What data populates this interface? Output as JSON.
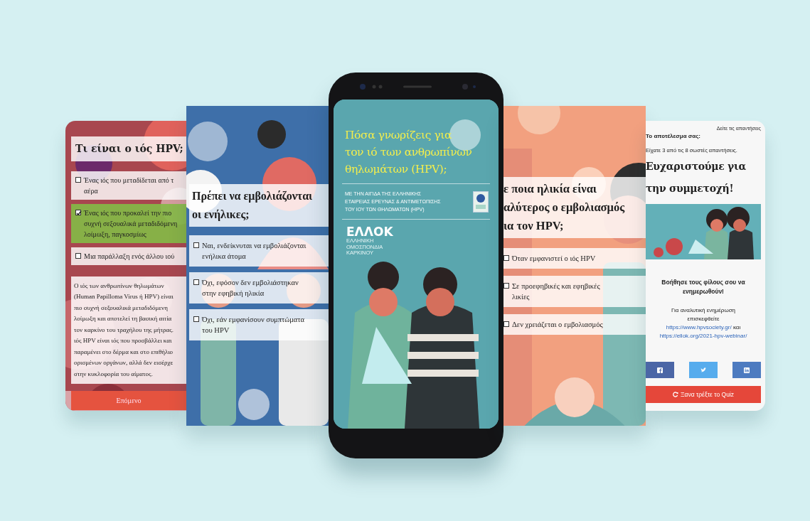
{
  "screens": [
    {
      "kind": "quiz",
      "title": "Τι είναι ο ιός HPV;",
      "options": [
        {
          "text": "Ένας ιός που μεταδίδεται από τ\nαέρα",
          "selected": false
        },
        {
          "text": "Ένας ιός που προκαλεί την πιο\nσυχνή σεξουαλικά μεταδιδόμενη\nλοίμωξη, παγκοσμίως",
          "selected": true
        },
        {
          "text": "Μια παράλλαξη ενός άλλου ιού",
          "selected": false
        }
      ],
      "explanation": "Ο ιός των ανθρωπίνων θηλωμάτων\n(Human Papilloma Virus ή HPV) είναι\nπιο συχνή σεξουαλικά μεταδιδόμενη\nλοίμωξη και αποτελεί τη βασική αιτία\nτον καρκίνο του τραχήλου της μήτρας.\nιός HPV είναι ιός που προσβάλλει και\nπαραμένει στο δέρμα και στο επιθήλιο\nορισμένων οργάνων, αλλά δεν εισέρχε\nστην κυκλοφορία του αίματος.",
      "next_button": "Επόμενο"
    },
    {
      "kind": "quiz",
      "title": "Πρέπει να εμβολιάζονται\nοι ενήλικες;",
      "options": [
        {
          "text": "Ναι, ενδείκνυται να εμβολιάζονται\nενήλικα άτομα",
          "selected": false
        },
        {
          "text": "Όχι, εφόσον δεν εμβολιάστηκαν\nστην εφηβική ηλικία",
          "selected": false
        },
        {
          "text": "Όχι, εάν εμφανίσουν συμπτώματα\nτου HPV",
          "selected": false
        }
      ]
    },
    {
      "kind": "cover",
      "title": "Πόσα γνωρίζεις για\nτον ιό των ανθρωπίνων\nθηλωμάτων (HPV);",
      "subtitle": "ΜΕ ΤΗΝ ΑΙΓΙΔΑ ΤΗΣ ΕΛΛΗΝΙΚΗΣ\nΕΤΑΙΡΕΙΑΣ ΕΡΕΥΝΑΣ & ΑΝΤΙΜΕΤΩΠΙΣΗΣ\nΤΟΥ ΙΟΥ ΤΩΝ ΘΗΛΩΜΑΤΩΝ (HPV)",
      "logo": "ΕΛΛΟΚ",
      "logo_caption": "ΕΛΛΗΝΙΚΗ\nΟΜΟΣΠΟΝΔΙΑ\nΚΑΡΚΙΝΟΥ"
    },
    {
      "kind": "quiz",
      "title": "ε ποια ηλικία είναι\nαλύτερος ο εμβολιασμός\nια τον HPV;",
      "options": [
        {
          "text": "Όταν εμφανιστεί ο ιός HPV",
          "selected": false
        },
        {
          "text": "Σε προεφηβικές και εφηβικές\nλικίες",
          "selected": false
        },
        {
          "text": "Δεν χρειάζεται ο εμβολιασμός",
          "selected": false
        }
      ]
    },
    {
      "kind": "result",
      "answers_link": "Δείτε τις απαντήσεις",
      "result_label": "Το αποτέλεσμα σας:",
      "score": "Είχατε 3 από τις 8 σωστές απαντήσεις.",
      "title": "Ευχαριστούμε για\nτην συμμετοχή!",
      "share_prompt": "Βοήθησε τους φίλους σου να\nενημερωθούν!",
      "info_text": "Για αναλυτική ενημέρωση\nεπισκεφθείτε",
      "links": [
        "https://www.hpvsociety.gr/",
        "https://ellok.org/2021-hpv-webinar/"
      ],
      "link_joiner": "και",
      "share_buttons": [
        {
          "kind": "facebook"
        },
        {
          "kind": "twitter"
        },
        {
          "kind": "linkedin"
        }
      ],
      "restart_button": "Ξανα τρέξτε το Quiz"
    }
  ]
}
